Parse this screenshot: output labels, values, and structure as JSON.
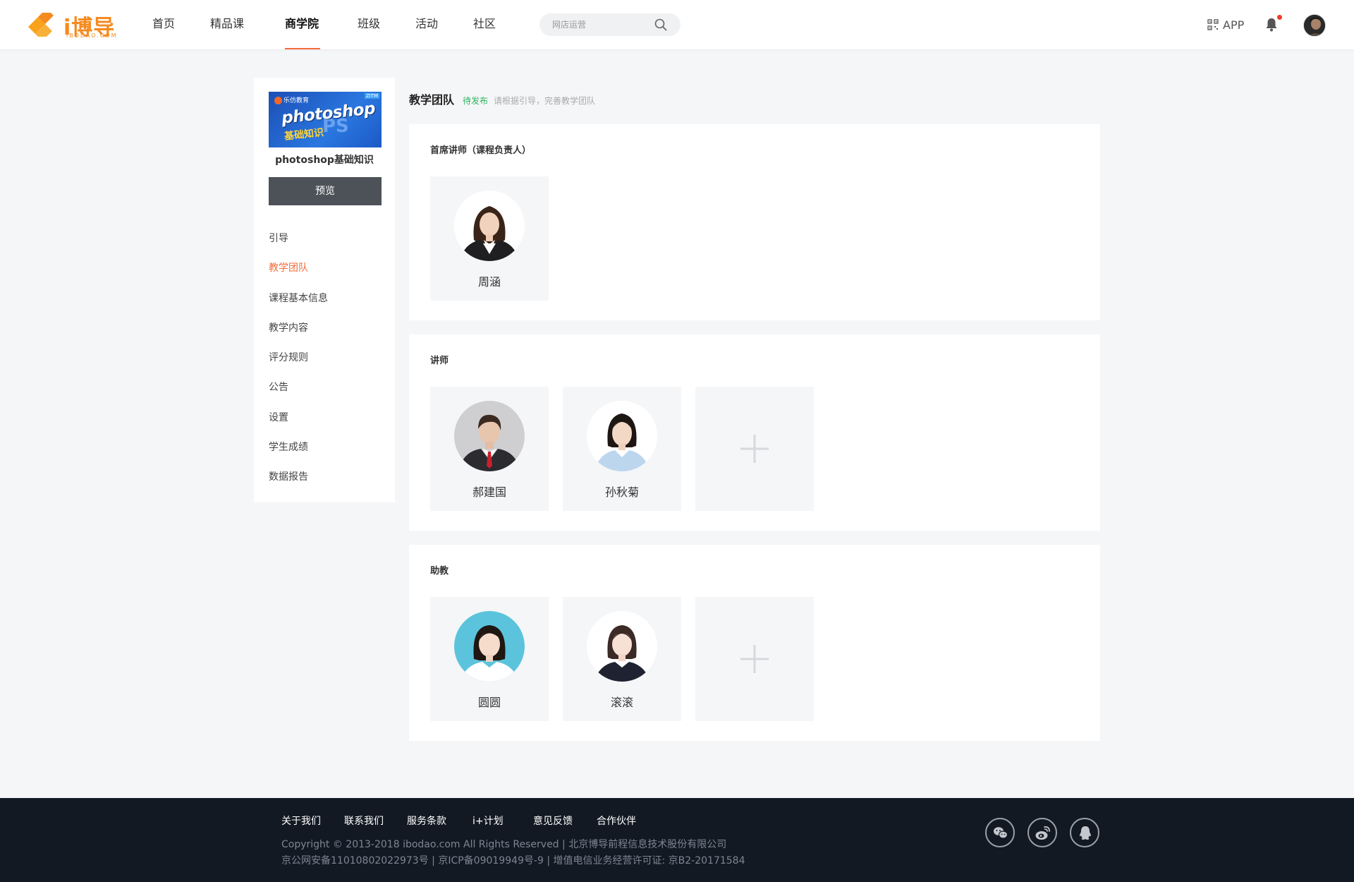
{
  "header": {
    "logo_text": "i博导",
    "logo_sub": "iBODAO.COM",
    "nav": [
      {
        "label": "首页"
      },
      {
        "label": "精品课"
      },
      {
        "label": "商学院"
      },
      {
        "label": "班级"
      },
      {
        "label": "活动"
      },
      {
        "label": "社区"
      }
    ],
    "active_nav": "商学院",
    "search_placeholder": "网店运营",
    "app_label": "APP",
    "accent_color": "#f56b3a"
  },
  "sidebar": {
    "cover": {
      "brand": "乐仿教育",
      "tag": "ZITM",
      "line1": "photoshop",
      "line2": "基础知识",
      "watermark": "PS"
    },
    "course_name": "photoshop基础知识",
    "preview_label": "预览",
    "menu": [
      {
        "label": "引导"
      },
      {
        "label": "教学团队"
      },
      {
        "label": "课程基本信息"
      },
      {
        "label": "教学内容"
      },
      {
        "label": "评分规则"
      },
      {
        "label": "公告"
      },
      {
        "label": "设置"
      },
      {
        "label": "学生成绩"
      },
      {
        "label": "数据报告"
      }
    ],
    "active_menu": "教学团队"
  },
  "main": {
    "title": "教学团队",
    "status": "待发布",
    "hint": "请根据引导，完善教学团队",
    "sections": [
      {
        "title": "首席讲师（课程负责人）",
        "members": [
          {
            "name": "周涵"
          }
        ]
      },
      {
        "title": "讲师",
        "members": [
          {
            "name": "郝建国"
          },
          {
            "name": "孙秋菊"
          }
        ]
      },
      {
        "title": "助教",
        "members": [
          {
            "name": "圆圆"
          },
          {
            "name": "滚滚"
          }
        ]
      }
    ]
  },
  "footer": {
    "links": [
      {
        "label": "关于我们"
      },
      {
        "label": "联系我们"
      },
      {
        "label": "服务条款"
      },
      {
        "label": "i+计划"
      },
      {
        "label": "意见反馈"
      },
      {
        "label": "合作伙伴"
      }
    ],
    "copyright": "Copyright © 2013-2018 ibodao.com All Rights Reserved | 北京博导前程信息技术股份有限公司",
    "license": "京公网安备11010802022973号 |  京ICP备09019949号-9  |  增值电信业务经营许可证:  京B2-20171584",
    "social": [
      "wechat-icon",
      "weibo-icon",
      "qq-icon"
    ]
  }
}
